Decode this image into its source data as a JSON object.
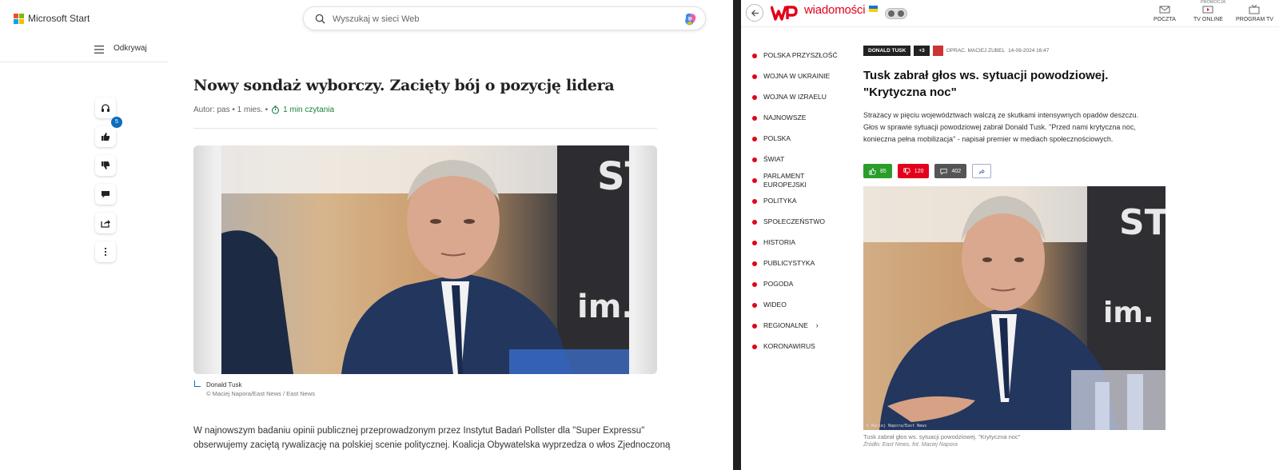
{
  "left_window": {
    "brand": "Microsoft Start",
    "search": {
      "placeholder": "Wyszukaj w sieci Web"
    },
    "nav": {
      "label": "Odkrywaj"
    },
    "actions": {
      "likes_badge": "5"
    },
    "article": {
      "title": "Nowy sondaż wyborczy. Zacięty bój o pozycję lidera",
      "byline_prefix": "Autor: pas • 1 mies. •",
      "read_time": "1 min czytania",
      "caption_name": "Donald Tusk",
      "caption_credit": "© Maciej Napora/East News / East News",
      "body": "W najnowszym badaniu opinii publicznej przeprowadzonym przez Instytut Badań Pollster dla \"Super Expressu\" obserwujemy zaciętą rywalizację na polskiej scenie politycznej. Koalicja Obywatelska wyprzedza o włos Zjednoczoną"
    }
  },
  "right_window": {
    "brand": "wiadomości",
    "top_links": [
      {
        "label": "POCZTA",
        "icon": "mail-icon"
      },
      {
        "label": "TV ONLINE",
        "icon": "tv-play-icon"
      },
      {
        "label": "PROGRAM TV",
        "icon": "tv-icon"
      }
    ],
    "promo_label": "PROMOCJA",
    "nav_items": [
      "POLSKA PRZYSZŁOŚĆ",
      "WOJNA W UKRAINIE",
      "WOJNA W IZRAELU",
      "NAJNOWSZE",
      "POLSKA",
      "ŚWIAT",
      "PARLAMENT EUROPEJSKI",
      "POLITYKA",
      "SPOŁECZEŃSTWO",
      "HISTORIA",
      "PUBLICYSTYKA",
      "POGODA",
      "WIDEO",
      "REGIONALNE",
      "KORONAWIRUS"
    ],
    "article": {
      "tag": "DONALD TUSK",
      "tag_more": "+3",
      "author": "OPRAC. MACIEJ ZUBEL",
      "date": "14-09-2024 16:47",
      "title": "Tusk zabrał głos ws. sytuacji powodziowej. \"Krytyczna noc\"",
      "lead": "Strażacy w pięciu województwach walczą ze skutkami intensywnych opadów deszczu. Głos w sprawie sytuacji powodziowej zabrał Donald Tusk. \"Przed nami krytyczna noc, konieczna pełna mobilizacja\" - napisał premier w mediach społecznościowych.",
      "likes": "85",
      "dislikes": "120",
      "comments": "402",
      "photo_watermark": "© Maciej Napora/East News",
      "caption": "Tusk zabrał głos ws. sytuacji powodziowej. \"Krytyczna noc\"",
      "source": "Źródło: East News, fot. Maciej Napora"
    }
  },
  "colors": {
    "msn_blue": "#0f6cbd",
    "wp_red": "#e2001a",
    "read_green": "#1b7f3b"
  }
}
